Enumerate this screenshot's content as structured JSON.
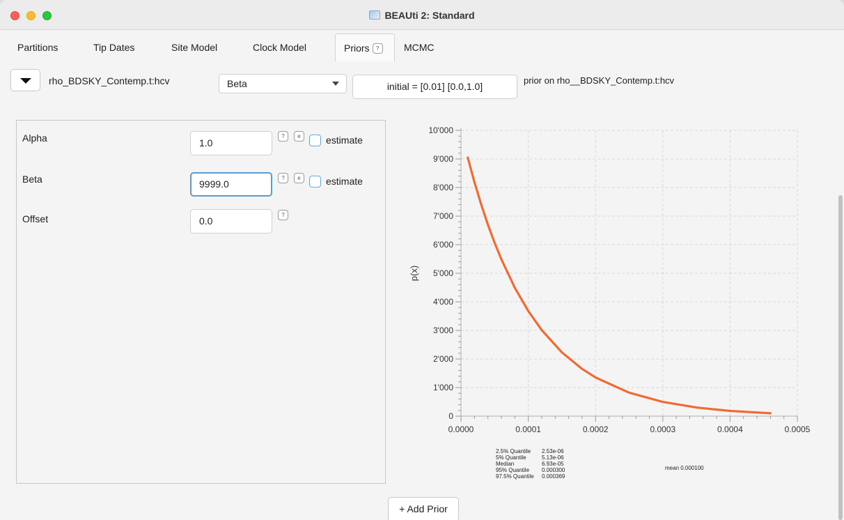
{
  "window": {
    "title": "BEAUti 2: Standard"
  },
  "tabs": [
    {
      "label": "Partitions"
    },
    {
      "label": "Tip Dates"
    },
    {
      "label": "Site Model"
    },
    {
      "label": "Clock Model"
    },
    {
      "label": "Priors",
      "help": "?"
    },
    {
      "label": "MCMC"
    }
  ],
  "prior_row": {
    "parameter": "rho_BDSKY_Contemp.t:hcv",
    "distribution": "Beta",
    "initial": "initial = [0.01] [0.0,1.0]",
    "prior_on": "prior on rho__BDSKY_Contemp.t:hcv"
  },
  "params": [
    {
      "label": "Alpha",
      "value": "1.0",
      "help": "?",
      "edit": "e",
      "estimate_label": "estimate",
      "estimate": false
    },
    {
      "label": "Beta",
      "value": "9999.0",
      "help": "?",
      "edit": "e",
      "estimate_label": "estimate",
      "estimate": false
    },
    {
      "label": "Offset",
      "value": "0.0",
      "help": "?"
    }
  ],
  "chart_data": {
    "type": "line",
    "ylabel": "p(x)",
    "xlim": [
      0,
      0.0005
    ],
    "ylim": [
      0,
      10000
    ],
    "x_ticks": [
      "0.0000",
      "0.0001",
      "0.0002",
      "0.0003",
      "0.0004",
      "0.0005"
    ],
    "y_ticks": [
      "0",
      "1'000",
      "2'000",
      "3'000",
      "4'000",
      "5'000",
      "6'000",
      "7'000",
      "8'000",
      "9'000",
      "10'000"
    ],
    "grid": true,
    "line_color": "#f26a33",
    "series": [
      {
        "x": [
          1e-05,
          2e-05,
          3e-05,
          4e-05,
          5e-05,
          6e-05,
          8e-05,
          0.0001,
          0.00012,
          0.00015,
          0.00018,
          0.0002,
          0.00025,
          0.0003,
          0.00035,
          0.0004,
          0.00046
        ],
        "y": [
          9048,
          8187,
          7408,
          6703,
          6065,
          5488,
          4493,
          3679,
          3012,
          2231,
          1653,
          1353,
          821,
          498,
          302,
          183,
          100
        ]
      }
    ]
  },
  "stats": [
    {
      "key": "2.5% Quantile",
      "value": "2.53e-06"
    },
    {
      "key": "5% Quantile",
      "value": "5.13e-06"
    },
    {
      "key": "Median",
      "value": "6.93e-05"
    },
    {
      "key": "95% Quantile",
      "value": "0.000300"
    },
    {
      "key": "97.5% Quantile",
      "value": "0.000369"
    }
  ],
  "mean": "mean 0.000100",
  "add_prior_label": "+ Add Prior"
}
